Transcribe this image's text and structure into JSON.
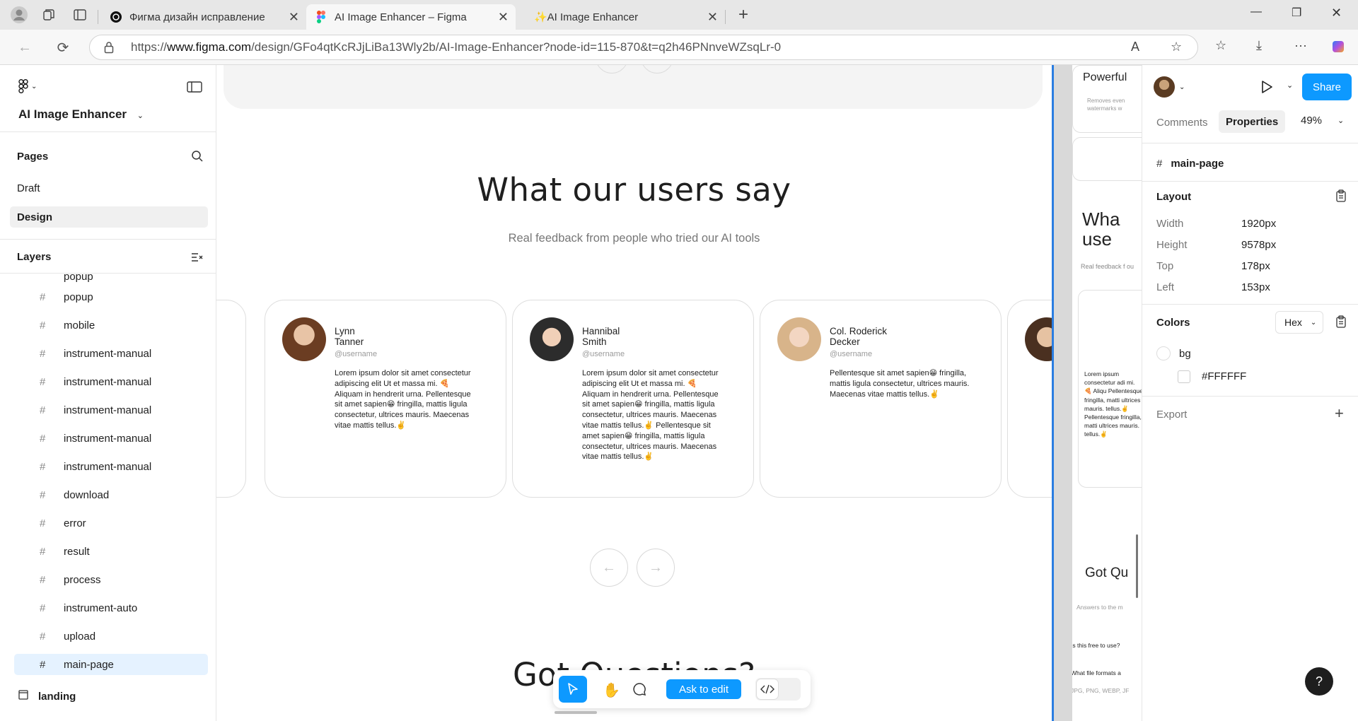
{
  "browser": {
    "tabs": [
      {
        "label": "Фигма дизайн исправление",
        "active": false
      },
      {
        "label": "AI Image Enhancer – Figma",
        "active": true
      },
      {
        "label": "✨AI Image Enhancer",
        "active": false
      }
    ],
    "url_prefix": "https://",
    "url_host": "www.figma.com",
    "url_path": "/design/GFo4qtKcRJjLiBa13Wly2b/AI-Image-Enhancer?node-id=115-870&t=q2h46PNnveWZsqLr-0"
  },
  "left_panel": {
    "file_name": "AI Image Enhancer",
    "pages_title": "Pages",
    "pages": [
      "Draft",
      "Design"
    ],
    "selected_page": "Design",
    "layers_title": "Layers",
    "layers": [
      "popup",
      "popup",
      "mobile",
      "instrument-manual",
      "instrument-manual",
      "instrument-manual",
      "instrument-manual",
      "instrument-manual",
      "download",
      "error",
      "result",
      "process",
      "instrument-auto",
      "upload",
      "main-page"
    ],
    "selected_layer": "main-page",
    "landing": "landing"
  },
  "canvas": {
    "heading": "What our users say",
    "subheading": "Real feedback from people who tried our AI tools",
    "cards": [
      {
        "name": "Lynn\nTanner",
        "username": "@username",
        "text": "Lorem ipsum dolor sit amet consectetur adipiscing elit Ut et massa mi. 🍕 Aliquam in hendrerit urna. Pellentesque sit amet sapien😁 fringilla, mattis ligula consectetur, ultrices mauris. Maecenas vitae mattis tellus.✌️",
        "avatar_color": "#7a4a2a"
      },
      {
        "name": "Hannibal\nSmith",
        "username": "@username",
        "text": "Lorem ipsum dolor sit amet consectetur adipiscing elit Ut et massa mi. 🍕 Aliquam in hendrerit urna. Pellentesque sit amet sapien😁 fringilla, mattis ligula consectetur, ultrices mauris. Maecenas vitae mattis tellus.✌️ Pellentesque sit amet sapien😁 fringilla, mattis ligula consectetur, ultrices mauris. Maecenas vitae mattis tellus.✌️",
        "avatar_color": "#3b3b3b"
      },
      {
        "name": "Col. Roderick\nDecker",
        "username": "@username",
        "text": "Pellentesque sit amet sapien😁 fringilla, mattis ligula consectetur, ultrices mauris. Maecenas vitae mattis tellus.✌️",
        "avatar_color": "#d9b79a"
      }
    ],
    "next_heading": "Got Questions?",
    "toolbar": {
      "ask_label": "Ask to edit"
    }
  },
  "preview": {
    "top_title": "Powerful",
    "top_text": "Removes even watermarks w",
    "heading": "Wha use",
    "sub": "Real feedback f ou",
    "card_text": "Lorem ipsum consectetur adi mi. 🍕 Aliqu Pellentesque fringilla, matti ultrices mauris. tellus.✌️ Pellentesque fringilla, matti ultrices mauris. tellus.✌️",
    "faq_title": "Got Qu",
    "faq_sub": "Answers to the m",
    "q1": "Is this free to use?",
    "q2": "What file formats a",
    "a2": "JPG, PNG, WEBP, JF"
  },
  "right_panel": {
    "tabs": [
      "Comments",
      "Properties"
    ],
    "active_tab": "Properties",
    "zoom": "49%",
    "share_label": "Share",
    "frame_name": "main-page",
    "layout_title": "Layout",
    "layout": [
      {
        "label": "Width",
        "value": "1920px"
      },
      {
        "label": "Height",
        "value": "9578px"
      },
      {
        "label": "Top",
        "value": "178px"
      },
      {
        "label": "Left",
        "value": "153px"
      }
    ],
    "colors_title": "Colors",
    "color_format": "Hex",
    "color_var": "bg",
    "color_hex": "#FFFFFF",
    "export_title": "Export",
    "accent": "#0d99ff"
  }
}
